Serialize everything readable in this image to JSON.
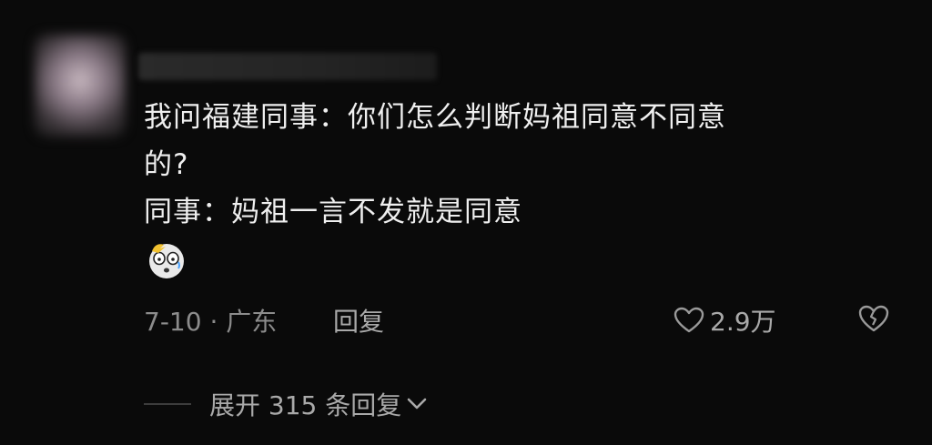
{
  "comment": {
    "lines": [
      "我问福建同事：你们怎么判断妈祖同意不同意",
      "的?",
      "同事：妈祖一言不发就是同意"
    ],
    "emoji": "shocked-face-emoji"
  },
  "meta": {
    "date_location": "7-10 · 广东",
    "reply_label": "回复",
    "like_count": "2.9万"
  },
  "replies": {
    "expand_label": "展开 315 条回复"
  },
  "icons": {
    "like": "heart-outline-icon",
    "dislike": "broken-heart-icon",
    "expand": "chevron-down-icon"
  }
}
